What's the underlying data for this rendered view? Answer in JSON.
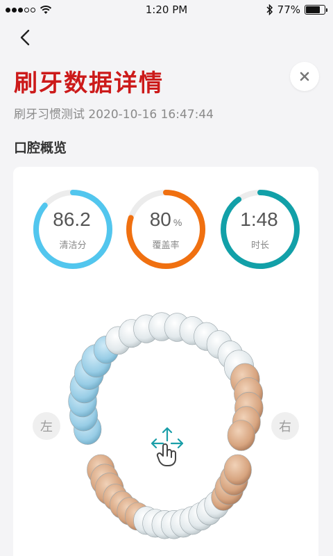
{
  "status_bar": {
    "time": "1:20 PM",
    "battery_percent": "77%",
    "battery_level": 0.77
  },
  "header": {
    "title": "刷牙数据详情",
    "subtitle": "刷牙习惯测试 2020-10-16 16:47:44"
  },
  "overview": {
    "section_title": "口腔概览",
    "stats": [
      {
        "value": "86.2",
        "unit": "",
        "label": "清洁分",
        "progress": 0.862,
        "color": "#52c6ee"
      },
      {
        "value": "80",
        "unit": "%",
        "label": "覆盖率",
        "progress": 0.8,
        "color": "#f07010"
      },
      {
        "value": "1:48",
        "unit": "",
        "label": "时长",
        "progress": 0.9,
        "color": "#12a0a8"
      }
    ],
    "left_label": "左",
    "right_label": "右",
    "colors": {
      "track": "#ececec",
      "tooth_white": "#e8eef0",
      "tooth_blue": "#9fd3ec",
      "tooth_orange": "#d9a883",
      "gesture": "#1a9ea8"
    }
  }
}
